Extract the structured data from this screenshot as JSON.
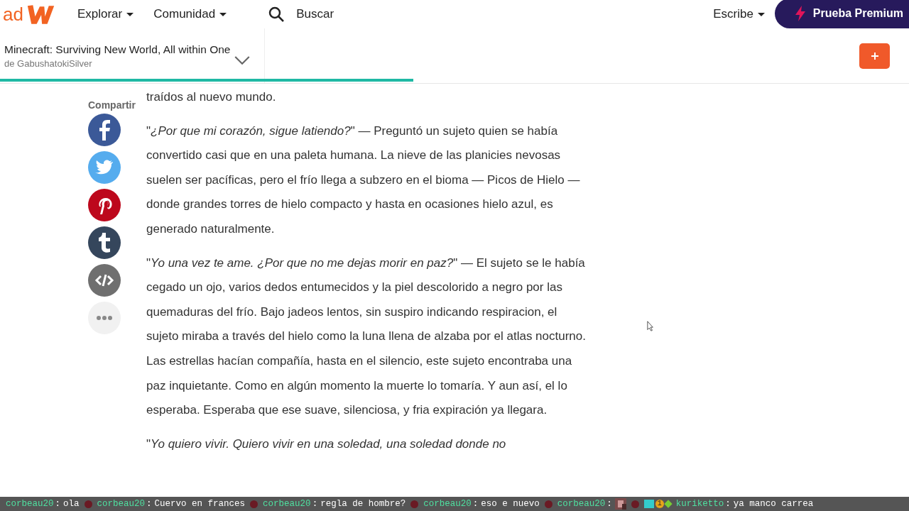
{
  "nav": {
    "logo_fragment": "ad",
    "menus": [
      {
        "label": "Explorar"
      },
      {
        "label": "Comunidad"
      }
    ],
    "search": {
      "placeholder": "Buscar"
    },
    "write": {
      "label": "Escribe"
    },
    "premium": {
      "label": "Prueba Premium"
    }
  },
  "story": {
    "title": "Minecraft: Surviving New World, All within One",
    "author": "de GabushatokiSilver",
    "progress": {
      "level": 0.455
    }
  },
  "share": {
    "label": "Compartir",
    "buttons": [
      {
        "kind": "facebook"
      },
      {
        "kind": "twitter"
      },
      {
        "kind": "pinterest"
      },
      {
        "kind": "tumblr"
      },
      {
        "kind": "embed"
      },
      {
        "kind": "more"
      }
    ]
  },
  "paragraphs": [
    "traídos al nuevo mundo.",
    "\"*¿Por que mi corazón, sigue latiendo?*\" — Preguntó un sujeto quien se había convertido casi que en una paleta humana. La nieve de las planicies nevosas suelen ser pacíficas, pero el frío llega a subzero en el bioma — Picos de Hielo — donde grandes torres de hielo compacto y hasta en ocasiones hielo azul, es generado naturalmente.",
    "\"*Yo una vez te ame. ¿Por que no me dejas morir en paz?*\" — El sujeto se le había cegado un ojo, varios dedos entumecidos y la piel descolorido a negro por las quemaduras del frío. Bajo jadeos lentos, sin suspiro indicando respiracion, el sujeto miraba a través del hielo como la luna llena de alzaba por el atlas nocturno. Las estrellas hacían compañía, hasta en el silencio, este sujeto encontraba una paz inquietante. Como en algún momento la muerte lo tomaría. Y aun así, el lo esperaba. Esperaba que ese suave, silenciosa, y fria expiración ya llegara.",
    "\"*Yo quiero vivir. Quiero vivir en una soledad, una soledad donde no*"
  ],
  "chat": [
    {
      "user": "corbeau20",
      "separator": ":",
      "message": "ola",
      "kind": "text"
    },
    {
      "user": "corbeau20",
      "separator": ":",
      "message": "Cuervo en frances",
      "kind": "text"
    },
    {
      "user": "corbeau20",
      "separator": ":",
      "message": "regla de hombre?",
      "kind": "text"
    },
    {
      "user": "corbeau20",
      "separator": ":",
      "message": "eso e nuevo",
      "kind": "text"
    },
    {
      "user": "corbeau20",
      "separator": ":",
      "kind": "emote"
    },
    {
      "user": "kuriketto",
      "separator": ":",
      "message": "ya manco carrea",
      "kind": "text",
      "badge": "1"
    }
  ]
}
